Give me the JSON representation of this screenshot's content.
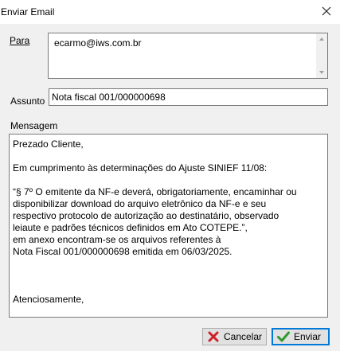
{
  "window": {
    "title": "Enviar Email"
  },
  "form": {
    "to_label": "Para",
    "to_value": "ecarmo@iws.com.br",
    "subject_label": "Assunto",
    "subject_value": "Nota fiscal 001/000000698",
    "message_label": "Mensagem",
    "message_lines": {
      "l1": "Prezado Cliente,",
      "l2": "Em cumprimento às determinações do Ajuste SINIEF 11/08:",
      "l3": "“§ 7º O emitente da NF-e deverá, obrigatoriamente, encaminhar ou",
      "l4": "disponibilizar download do arquivo eletrônico da NF-e e seu",
      "l5": "respectivo protocolo de autorização ao destinatário, observado",
      "l6": "leiaute e padrões técnicos definidos em Ato COTEPE.”,",
      "l7": "em anexo encontram-se os arquivos referentes à",
      "l8": "Nota Fiscal 001/000000698 emitida em 06/03/2025.",
      "l9": "Atenciosamente,"
    }
  },
  "buttons": {
    "cancel_label": "Cancelar",
    "send_label": "Enviar"
  },
  "icons": {
    "close": "close-icon",
    "cancel": "red-x-icon",
    "send": "green-check-icon"
  },
  "colors": {
    "cancel_icon": "#d0202a",
    "send_icon": "#2e9a2e",
    "focus_border": "#0078d7"
  }
}
